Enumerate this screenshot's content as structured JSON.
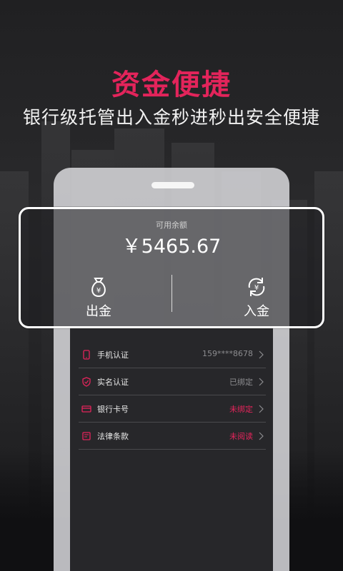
{
  "promo": {
    "headline": "资金便捷",
    "subline": "银行级托管出入金秒进秒出安全便捷"
  },
  "balance_card": {
    "label": "可用余额",
    "amount": "￥5465.67",
    "withdraw": {
      "icon": "money-bag-icon",
      "label": "出金"
    },
    "deposit": {
      "icon": "yen-exchange-icon",
      "label": "入金"
    }
  },
  "list": [
    {
      "icon": "phone-icon",
      "label": "手机认证",
      "value": "159****8678",
      "value_color": "#8c8c8f"
    },
    {
      "icon": "shield-icon",
      "label": "实名认证",
      "value": "已绑定",
      "value_color": "#8c8c8f"
    },
    {
      "icon": "bank-card-icon",
      "label": "银行卡号",
      "value": "未绑定",
      "value_color": "#e3245b"
    },
    {
      "icon": "document-icon",
      "label": "法律条款",
      "value": "未阅读",
      "value_color": "#e3245b"
    }
  ],
  "colors": {
    "accent": "#e3245b",
    "muted": "#8c8c8f"
  }
}
